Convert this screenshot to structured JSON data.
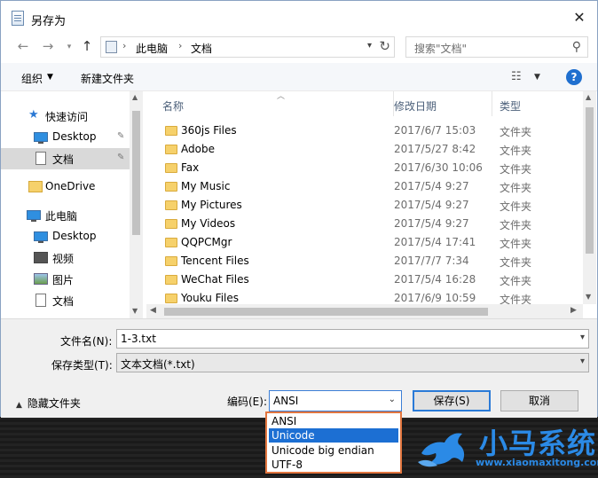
{
  "window": {
    "title": "另存为",
    "close": "✕"
  },
  "address": {
    "crumbs": [
      "此电脑",
      "文档"
    ]
  },
  "search": {
    "placeholder": "搜索\"文档\""
  },
  "toolbar": {
    "organize": "组织",
    "new_folder": "新建文件夹"
  },
  "nav": {
    "items": [
      {
        "label": "快速访问",
        "icon": "star-icon"
      },
      {
        "label": "Desktop",
        "icon": "desktop-icon",
        "pinned": true
      },
      {
        "label": "文档",
        "icon": "document-icon",
        "pinned": true,
        "selected": true
      },
      {
        "label": "OneDrive",
        "icon": "folder-icon"
      },
      {
        "label": "此电脑",
        "icon": "computer-icon"
      },
      {
        "label": "Desktop",
        "icon": "desktop-icon"
      },
      {
        "label": "视频",
        "icon": "video-icon"
      },
      {
        "label": "图片",
        "icon": "picture-icon"
      },
      {
        "label": "文档",
        "icon": "document-icon"
      }
    ]
  },
  "columns": {
    "name": "名称",
    "date": "修改日期",
    "type": "类型"
  },
  "files": [
    {
      "name": "360js Files",
      "date": "2017/6/7 15:03",
      "type": "文件夹"
    },
    {
      "name": "Adobe",
      "date": "2017/5/27 8:42",
      "type": "文件夹"
    },
    {
      "name": "Fax",
      "date": "2017/6/30 10:06",
      "type": "文件夹"
    },
    {
      "name": "My Music",
      "date": "2017/5/4 9:27",
      "type": "文件夹"
    },
    {
      "name": "My Pictures",
      "date": "2017/5/4 9:27",
      "type": "文件夹"
    },
    {
      "name": "My Videos",
      "date": "2017/5/4 9:27",
      "type": "文件夹"
    },
    {
      "name": "QQPCMgr",
      "date": "2017/5/4 17:41",
      "type": "文件夹"
    },
    {
      "name": "Tencent Files",
      "date": "2017/7/7 7:34",
      "type": "文件夹"
    },
    {
      "name": "WeChat Files",
      "date": "2017/5/4 16:28",
      "type": "文件夹"
    },
    {
      "name": "Youku Files",
      "date": "2017/6/9 10:59",
      "type": "文件夹"
    }
  ],
  "form": {
    "filename_label": "文件名(N):",
    "filename_value": "1-3.txt",
    "filetype_label": "保存类型(T):",
    "filetype_value": "文本文档(*.txt)",
    "hide_folders": "隐藏文件夹",
    "encoding_label": "编码(E):",
    "encoding_value": "ANSI",
    "save": "保存(S)",
    "cancel": "取消"
  },
  "encoding_options": [
    "ANSI",
    "Unicode",
    "Unicode big endian",
    "UTF-8"
  ],
  "encoding_highlighted": "Unicode",
  "watermark": {
    "name": "小马系统",
    "url": "www.xiaomaxitong.com"
  },
  "colors": {
    "accent": "#1c6fd3",
    "highlight_border": "#e2763f",
    "watermark": "#2b8ae6"
  }
}
